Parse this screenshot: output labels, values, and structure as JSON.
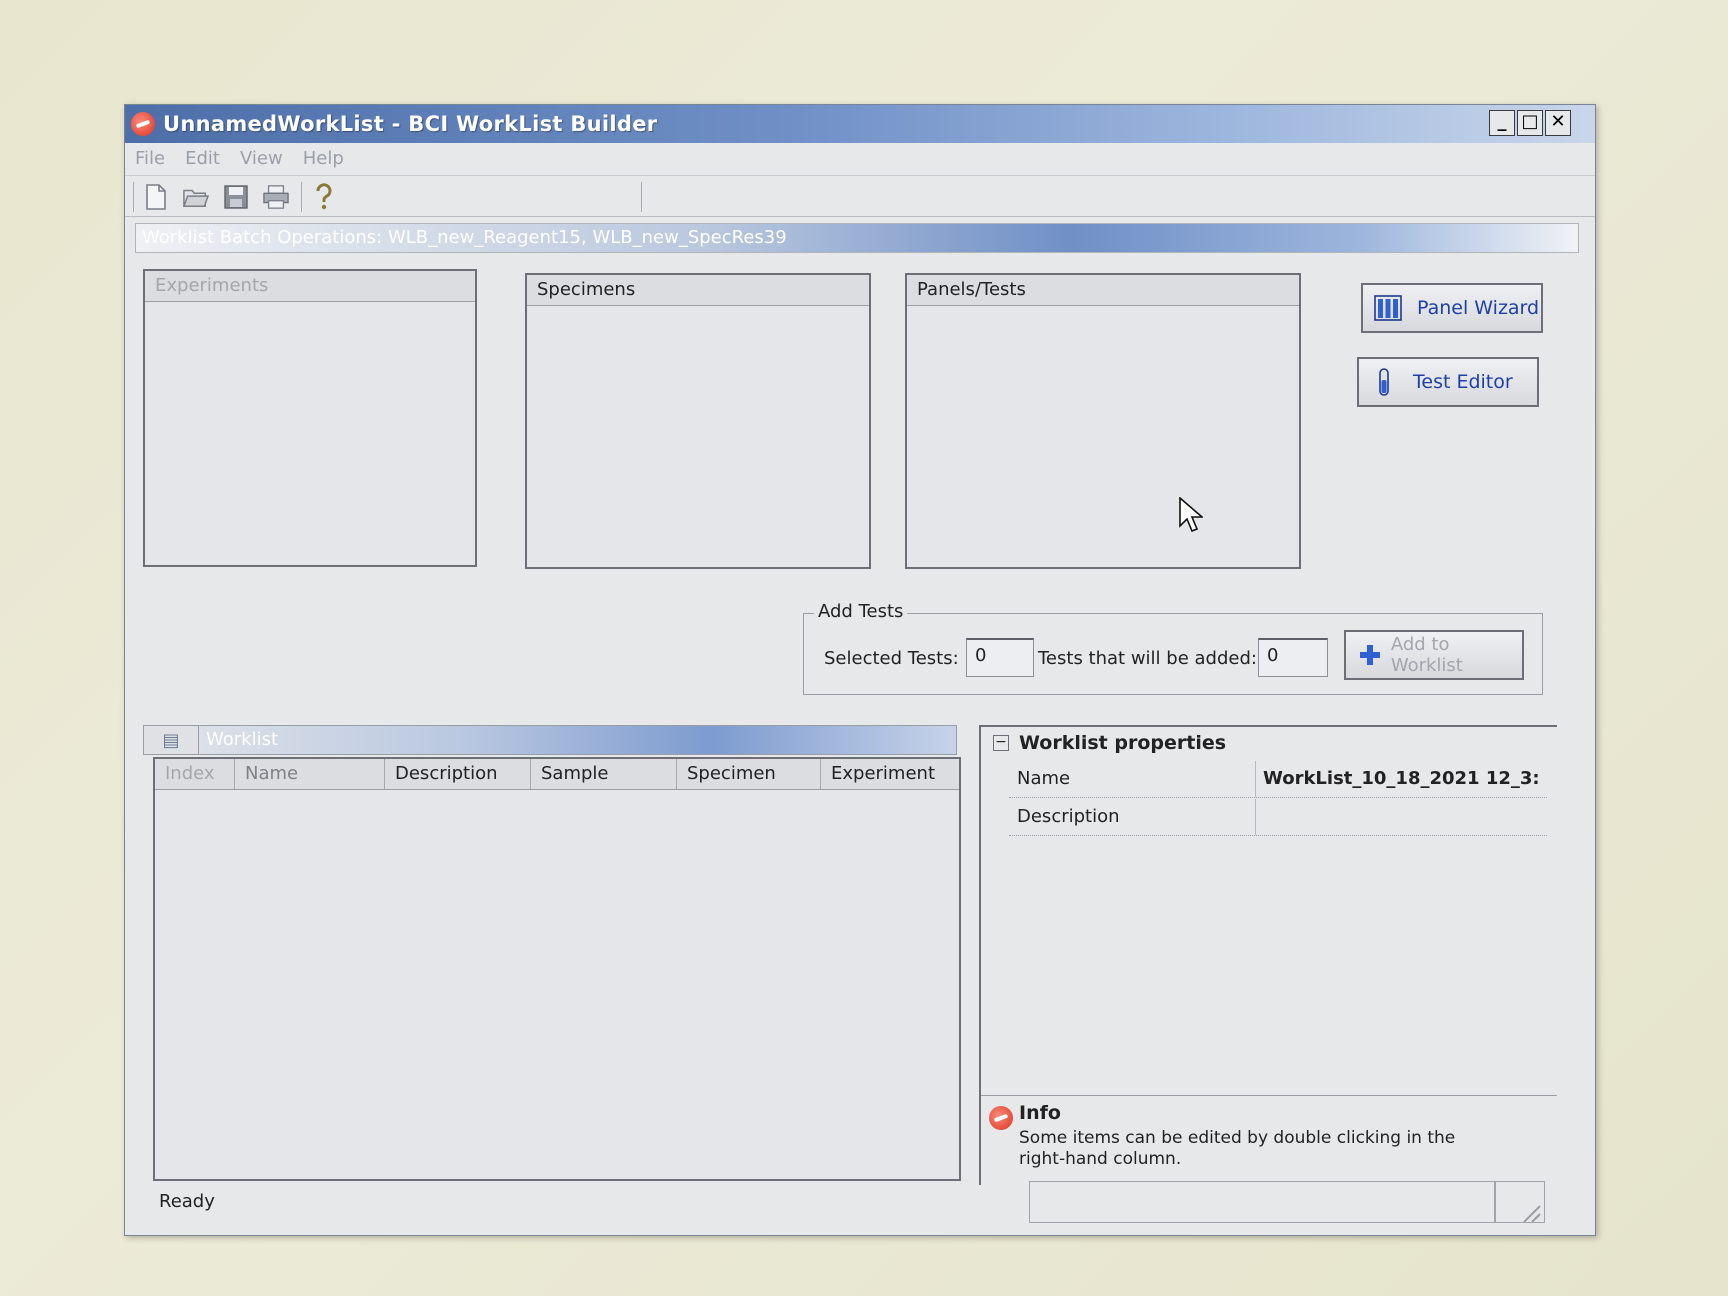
{
  "window": {
    "title": "UnnamedWorkList - BCI WorkList Builder",
    "controls": {
      "minimize": "_",
      "maximize": "□",
      "close": "✕"
    }
  },
  "menu": [
    "File",
    "Edit",
    "View",
    "Help"
  ],
  "toolbar": {
    "icons": [
      "new-file-icon",
      "open-folder-icon",
      "save-icon",
      "print-icon",
      "help-icon"
    ]
  },
  "batch": {
    "label": "Worklist Batch Operations: WLB_new_Reagent15, WLB_new_SpecRes39"
  },
  "panes": {
    "experiments": "Experiments",
    "specimens": "Specimens",
    "panels_tests": "Panels/Tests"
  },
  "buttons": {
    "panel_wizard": "Panel Wizard",
    "test_editor": "Test Editor",
    "add_to_worklist": "Add to Worklist"
  },
  "add_tests": {
    "legend": "Add Tests",
    "selected_label": "Selected Tests:",
    "selected_value": "0",
    "will_add_label": "Tests that will be added:",
    "will_add_value": "0"
  },
  "worklist": {
    "title": "Worklist",
    "columns": [
      "Index",
      "Name",
      "Description",
      "Sample",
      "Specimen",
      "Experiment"
    ]
  },
  "properties": {
    "title": "Worklist properties",
    "rows": [
      {
        "key": "Name",
        "value": "WorkList_10_18_2021 12_3:"
      },
      {
        "key": "Description",
        "value": ""
      }
    ]
  },
  "info": {
    "title": "Info",
    "text": "Some items can be edited by double clicking in the right-hand column."
  },
  "status": {
    "text": "Ready"
  }
}
